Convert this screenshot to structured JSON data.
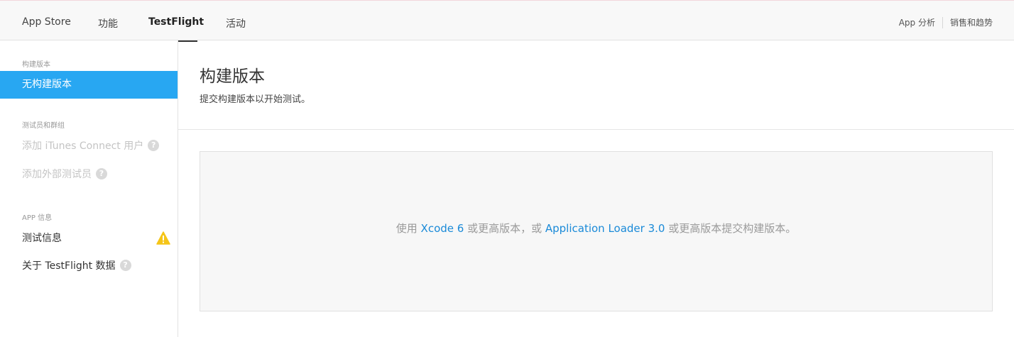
{
  "topnav": {
    "tabs": [
      {
        "label": "App Store"
      },
      {
        "label": "功能"
      },
      {
        "label": "TestFlight",
        "active": true
      },
      {
        "label": "活动"
      }
    ],
    "right_links": [
      "App 分析",
      "销售和趋势"
    ]
  },
  "sidebar": {
    "section_builds": "构建版本",
    "item_no_builds": "无构建版本",
    "section_testers": "测试员和群组",
    "item_add_itunes_users": "添加 iTunes Connect 用户",
    "item_add_external_testers": "添加外部测试员",
    "section_app_info": "APP 信息",
    "item_test_info": "测试信息",
    "item_about_testflight_data": "关于 TestFlight 数据",
    "help_glyph": "?"
  },
  "main": {
    "title": "构建版本",
    "subtitle": "提交构建版本以开始测试。",
    "empty": {
      "prefix": "使用 ",
      "link1": "Xcode 6",
      "middle": " 或更高版本，或 ",
      "link2": "Application Loader 3.0",
      "suffix": " 或更高版本提交构建版本。"
    }
  },
  "colors": {
    "accent": "#28a7f2",
    "link": "#1a8ad8",
    "warning": "#f5c518"
  },
  "icons": [
    "help-icon",
    "warning-icon"
  ]
}
